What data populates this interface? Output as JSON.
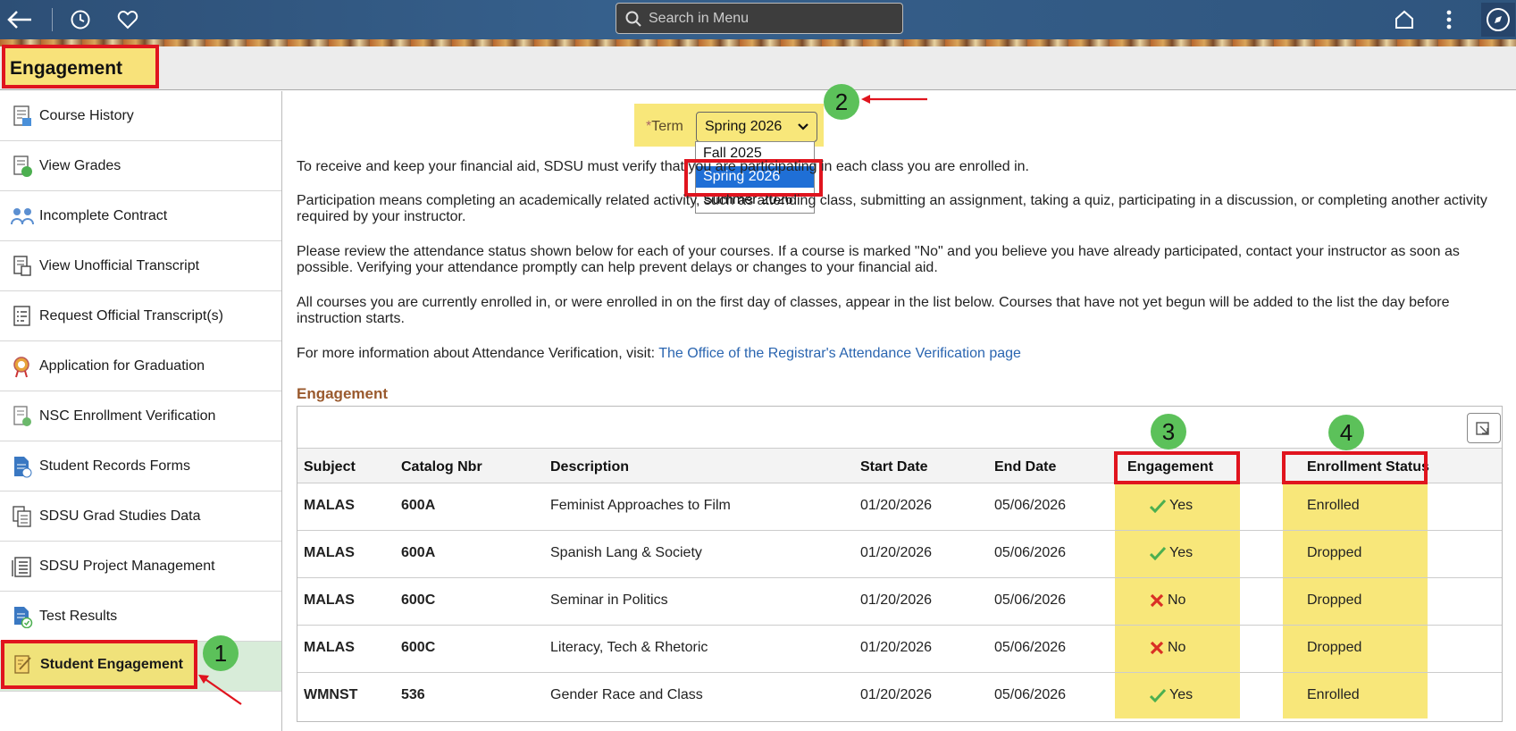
{
  "header": {
    "search_placeholder": "Search in Menu"
  },
  "page_title": "Engagement",
  "sidebar": {
    "items": [
      {
        "label": "Course History",
        "icon": "course-history-icon"
      },
      {
        "label": "View Grades",
        "icon": "grades-icon"
      },
      {
        "label": "Incomplete Contract",
        "icon": "contract-icon"
      },
      {
        "label": "View Unofficial Transcript",
        "icon": "transcript-icon"
      },
      {
        "label": "Request Official Transcript(s)",
        "icon": "request-transcript-icon"
      },
      {
        "label": "Application for Graduation",
        "icon": "graduation-icon"
      },
      {
        "label": "NSC Enrollment Verification",
        "icon": "verification-icon"
      },
      {
        "label": "Student Records Forms",
        "icon": "forms-icon"
      },
      {
        "label": "SDSU Grad Studies Data",
        "icon": "grad-data-icon"
      },
      {
        "label": "SDSU Project Management",
        "icon": "project-icon"
      },
      {
        "label": "Test Results",
        "icon": "test-results-icon"
      },
      {
        "label": "Student Engagement",
        "icon": "engagement-icon"
      }
    ]
  },
  "term": {
    "label": "Term",
    "required_mark": "*",
    "selected": "Spring 2026",
    "options": [
      "Fall 2025",
      "Spring 2026",
      "Summer 2026"
    ]
  },
  "badges": {
    "b1": "1",
    "b2": "2",
    "b3": "3",
    "b4": "4"
  },
  "paragraphs": {
    "p1": "To receive and keep your financial aid, SDSU must verify that you are participating in each class you are enrolled in.",
    "p2": "Participation means completing an academically related activity, such as attending class, submitting an assignment, taking a quiz, participating in a discussion, or completing another activity required by your instructor.",
    "p3": "Please review the attendance status shown below for each of your courses. If a course is marked \"No\" and you believe you have already participated, contact your instructor as soon as possible. Verifying your attendance promptly can help prevent delays or changes to your financial aid.",
    "p4": "All courses you are currently enrolled in, or were enrolled in on the first day of classes, appear in the list below. Courses that have not yet begun will be added to the list the day before instruction starts.",
    "p5_prefix": "For more information about Attendance Verification, visit: ",
    "p5_link": "The Office of the Registrar's Attendance Verification page"
  },
  "table": {
    "title": "Engagement",
    "columns": [
      "Subject",
      "Catalog Nbr",
      "Description",
      "Start Date",
      "End Date",
      "Engagement",
      "Enrollment Status"
    ],
    "rows": [
      {
        "subject": "MALAS",
        "catalog": "600A",
        "description": "Feminist Approaches to Film",
        "start": "01/20/2026",
        "end": "05/06/2026",
        "engagement": "Yes",
        "status": "Enrolled"
      },
      {
        "subject": "MALAS",
        "catalog": "600A",
        "description": "Spanish Lang & Society",
        "start": "01/20/2026",
        "end": "05/06/2026",
        "engagement": "Yes",
        "status": "Dropped"
      },
      {
        "subject": "MALAS",
        "catalog": "600C",
        "description": "Seminar in Politics",
        "start": "01/20/2026",
        "end": "05/06/2026",
        "engagement": "No",
        "status": "Dropped"
      },
      {
        "subject": "MALAS",
        "catalog": "600C",
        "description": "Literacy, Tech & Rhetoric",
        "start": "01/20/2026",
        "end": "05/06/2026",
        "engagement": "No",
        "status": "Dropped"
      },
      {
        "subject": "WMNST",
        "catalog": "536",
        "description": "Gender Race and Class",
        "start": "01/20/2026",
        "end": "05/06/2026",
        "engagement": "Yes",
        "status": "Enrolled"
      }
    ]
  },
  "colors": {
    "highlight": "#f8e77a",
    "callout_red": "#e0141e",
    "badge_green": "#5cc15a",
    "link": "#2a65b0"
  }
}
